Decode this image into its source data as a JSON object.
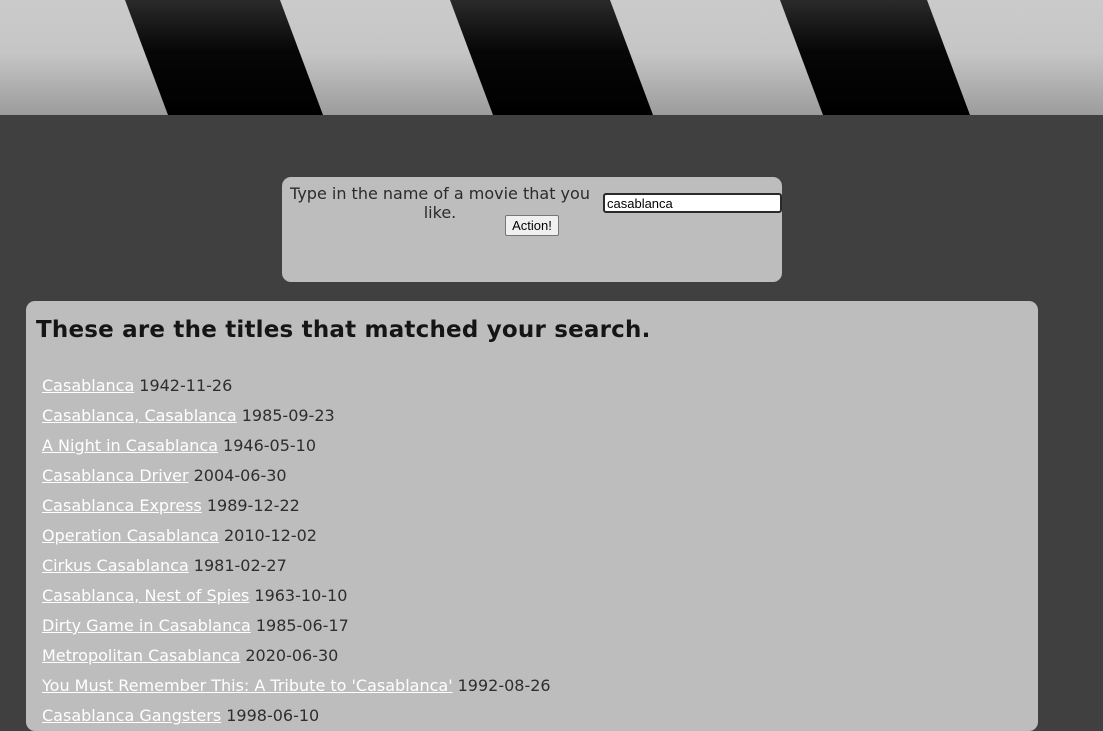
{
  "search": {
    "prompt": "Type in the name of a movie that you like.",
    "query": "casablanca",
    "button_label": "Action!"
  },
  "results": {
    "heading": "These are the titles that matched your search.",
    "items": [
      {
        "title": "Casablanca",
        "date": "1942-11-26"
      },
      {
        "title": "Casablanca, Casablanca",
        "date": "1985-09-23"
      },
      {
        "title": "A Night in Casablanca",
        "date": "1946-05-10"
      },
      {
        "title": "Casablanca Driver",
        "date": "2004-06-30"
      },
      {
        "title": "Casablanca Express",
        "date": "1989-12-22"
      },
      {
        "title": "Operation Casablanca",
        "date": "2010-12-02"
      },
      {
        "title": "Cirkus Casablanca",
        "date": "1981-02-27"
      },
      {
        "title": "Casablanca, Nest of Spies",
        "date": "1963-10-10"
      },
      {
        "title": "Dirty Game in Casablanca",
        "date": "1985-06-17"
      },
      {
        "title": "Metropolitan Casablanca",
        "date": "2020-06-30"
      },
      {
        "title": "You Must Remember This: A Tribute to 'Casablanca'",
        "date": "1992-08-26"
      },
      {
        "title": "Casablanca Gangsters",
        "date": "1998-06-10"
      }
    ]
  },
  "colors": {
    "page_background": "#404040",
    "panel_background": "#bdbdbd",
    "link": "#ffffff"
  }
}
